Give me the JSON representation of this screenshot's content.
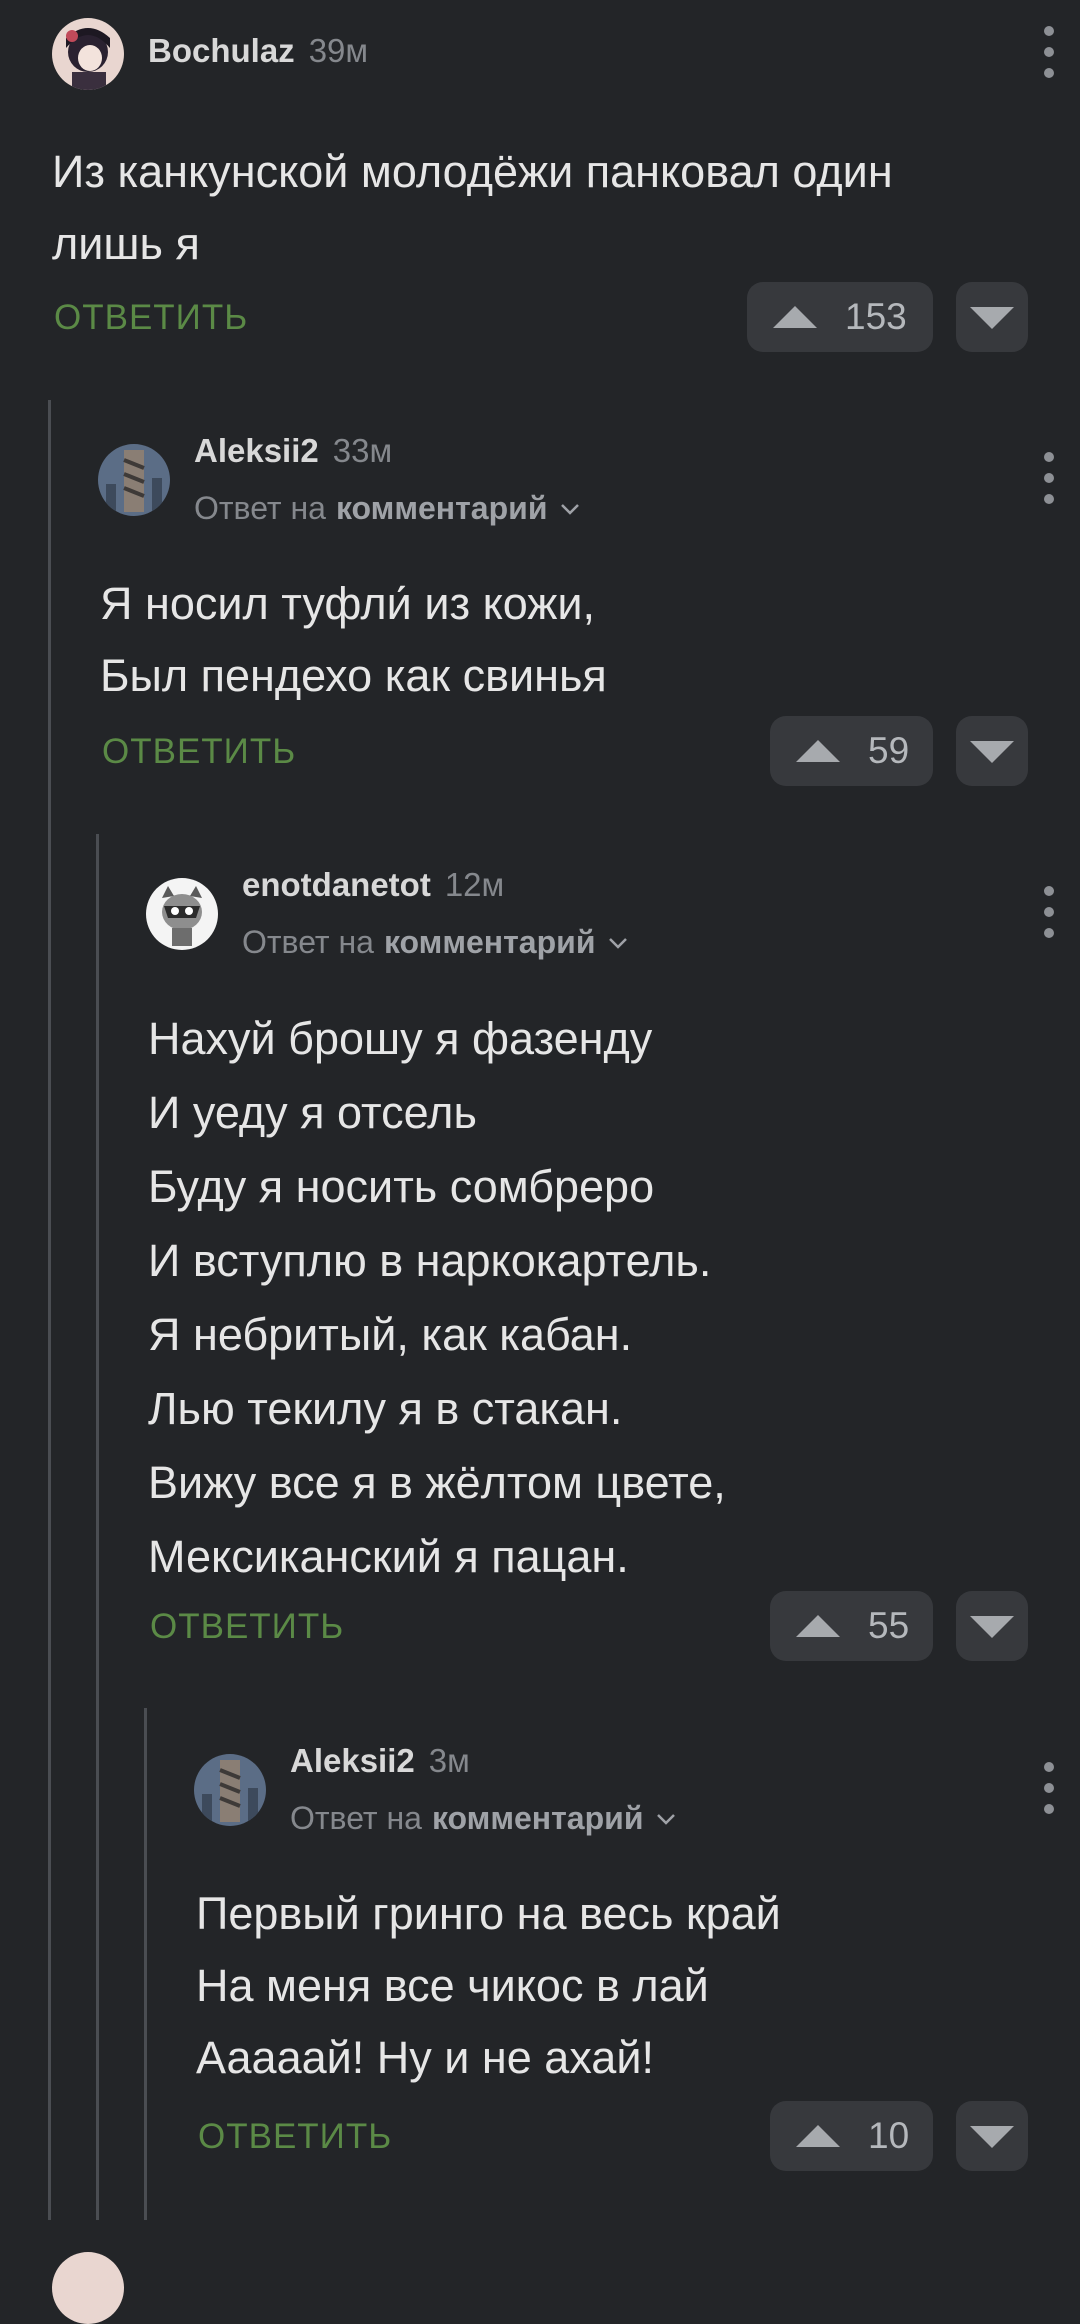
{
  "ui": {
    "reply_label": "ОТВЕТИТЬ",
    "reply_to_prefix": "Ответ на",
    "reply_to_target": "комментарий"
  },
  "comments": [
    {
      "username": "Bochulaz",
      "time": "39м",
      "lines": [
        "Из канкунской молодёжи панковал один",
        "лишь я"
      ],
      "votes": "153"
    },
    {
      "username": "Aleksii2",
      "time": "33м",
      "lines": [
        "Я носил туфли́ из кожи,",
        "Был пендехо как свинья"
      ],
      "votes": "59"
    },
    {
      "username": "enotdanetot",
      "time": "12м",
      "lines": [
        "Нахуй брошу я фазенду",
        "И уеду я отсель",
        "Буду я носить сомбреро",
        "И вступлю в наркокартель.",
        "Я небритый, как кабан.",
        "Лью текилу я в стакан.",
        "Вижу все я в жёлтом цвете,",
        "Мексиканский я пацан."
      ],
      "votes": "55"
    },
    {
      "username": "Aleksii2",
      "time": "3м",
      "lines": [
        "Первый гринго на весь край",
        "На меня все чикос в лай",
        "Ааааай! Ну и не ахай!"
      ],
      "votes": "10"
    }
  ]
}
